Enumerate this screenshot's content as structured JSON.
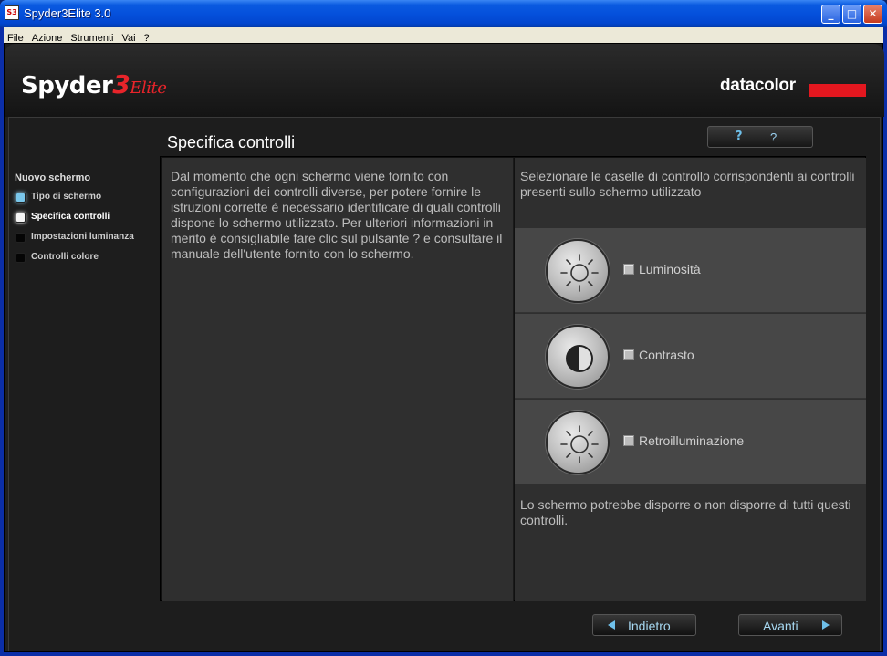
{
  "window": {
    "title": "Spyder3Elite 3.0",
    "icon_text": "S3",
    "controls": {
      "minimize": "_",
      "maximize": "□",
      "close": "✕"
    }
  },
  "menu": [
    "File",
    "Azione",
    "Strumenti",
    "Vai",
    "?"
  ],
  "branding": {
    "logo_word": "Spyder",
    "logo_number": "3",
    "logo_suffix": "Elite",
    "company": "datacolor"
  },
  "page": {
    "title": "Specifica controlli",
    "help_icon": "?",
    "help_label": "?"
  },
  "sidebar": {
    "title": "Nuovo schermo",
    "steps": [
      {
        "label": "Tipo di schermo",
        "state": "done"
      },
      {
        "label": "Specifica controlli",
        "state": "active"
      },
      {
        "label": "Impostazioni luminanza",
        "state": "pending"
      },
      {
        "label": "Controlli colore",
        "state": "pending"
      }
    ]
  },
  "left_panel": {
    "text": "Dal momento che ogni schermo viene fornito con configurazioni dei controlli diverse, per potere fornire le istruzioni corrette è necessario identificare di quali controlli dispone lo schermo utilizzato. Per ulteriori informazioni in merito è consigliabile fare clic sul pulsante ? e consultare il manuale dell'utente fornito con lo schermo."
  },
  "right_panel": {
    "intro": "Selezionare le caselle di controllo corrispondenti ai controlli presenti sullo schermo utilizzato",
    "controls": [
      {
        "label": "Luminosità",
        "icon": "brightness-icon",
        "checked": false
      },
      {
        "label": "Contrasto",
        "icon": "contrast-icon",
        "checked": false
      },
      {
        "label": "Retroilluminazione",
        "icon": "backlight-icon",
        "checked": false
      }
    ],
    "footer": "Lo schermo potrebbe disporre o non disporre di tutti questi controlli."
  },
  "navigation": {
    "back_label": "Indietro",
    "next_label": "Avanti"
  },
  "colors": {
    "accent_blue": "#6fc0ea",
    "brand_red": "#e3171f",
    "panel_bg": "#2f2f2f",
    "row_bg": "#474747"
  }
}
